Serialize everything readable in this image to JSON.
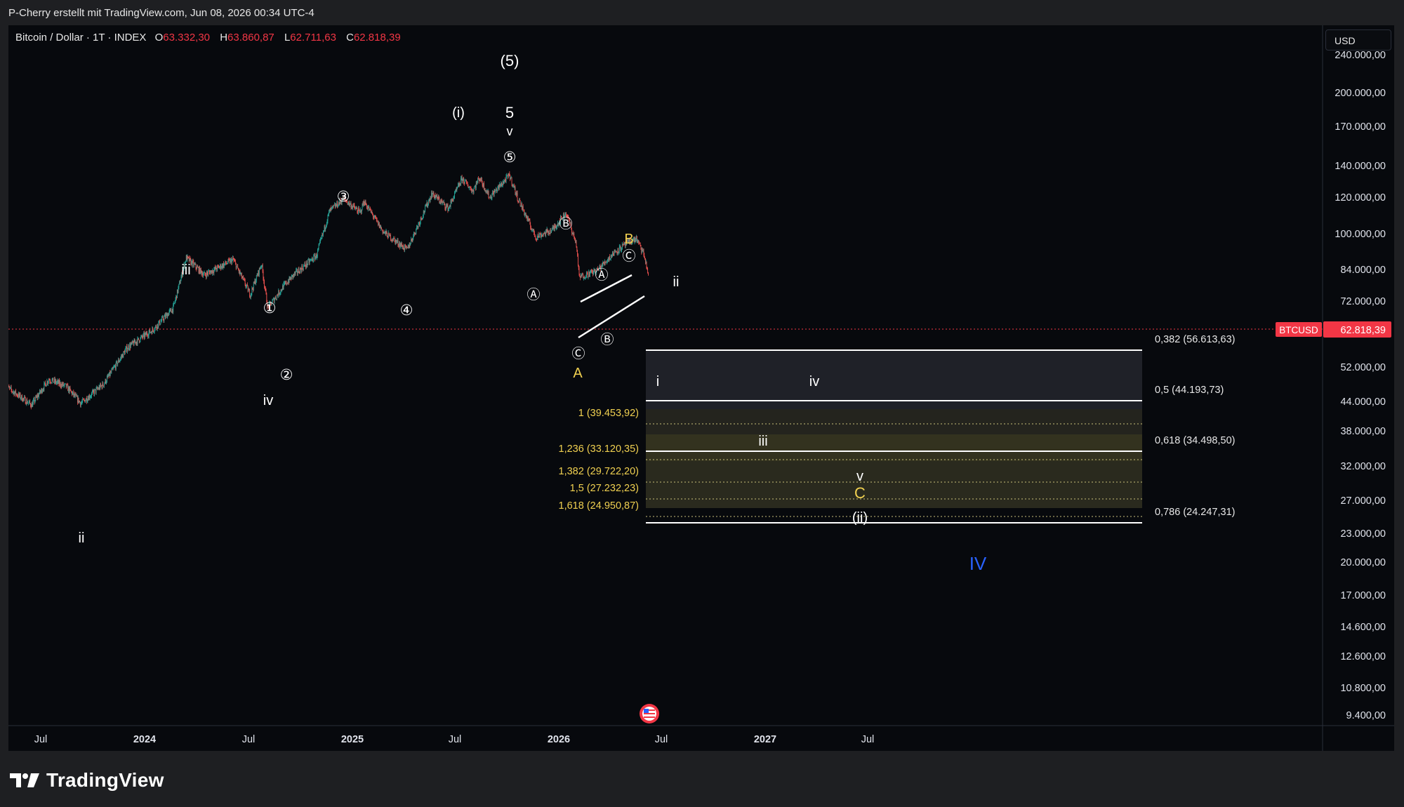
{
  "header": {
    "credit": "P-Cherry erstellt mit TradingView.com, Jun 08, 2026 00:34 UTC-4"
  },
  "legend": {
    "symbol": "Bitcoin / Dollar · 1T · INDEX",
    "open_label": "O",
    "open": "63.332,30",
    "high_label": "H",
    "high": "63.860,87",
    "low_label": "L",
    "low": "62.711,63",
    "close_label": "C",
    "close": "62.818,39"
  },
  "currency": "USD",
  "price_axis": {
    "ticks": [
      "240.000,00",
      "200.000,00",
      "170.000,00",
      "140.000,00",
      "120.000,00",
      "100.000,00",
      "84.000,00",
      "72.000,00",
      "52.000,00",
      "44.000,00",
      "38.000,00",
      "32.000,00",
      "27.000,00",
      "23.000,00",
      "20.000,00",
      "17.000,00",
      "14.600,00",
      "12.600,00",
      "10.800,00",
      "9.400,00"
    ]
  },
  "time_axis": {
    "ticks": [
      "Jul",
      "2024",
      "Jul",
      "2025",
      "Jul",
      "2026",
      "Jul",
      "2027",
      "Jul"
    ]
  },
  "price_tag": {
    "symbol": "BTCUSD",
    "value": "62.818,39"
  },
  "fib_right": [
    "0,382 (56.613,63)",
    "0,5 (44.193,73)",
    "0,618 (34.498,50)",
    "0,786 (24.247,31)"
  ],
  "fib_left": [
    "1 (39.453,92)",
    "1,236 (33.120,35)",
    "1,382 (29.722,20)",
    "1,5 (27.232,23)",
    "1,618 (24.950,87)"
  ],
  "wave_labels": {
    "w5_major": "(5)",
    "wi_paren": "(i)",
    "w5": "5",
    "wv_top": "v",
    "c5": "⑤",
    "c3": "③",
    "c1": "①",
    "c2": "②",
    "c4": "④",
    "iii_left": "iii",
    "iv_left": "iv",
    "ii_left": "ii",
    "cB_top": "Ⓑ",
    "cA_left": "Ⓐ",
    "cA_chan": "Ⓐ",
    "cC_chan": "Ⓒ",
    "cB_chan": "Ⓑ",
    "cC_bottom": "Ⓒ",
    "B": "B",
    "A": "A",
    "ii_right": "ii",
    "i_proj": "i",
    "iv_proj": "iv",
    "iii_proj": "iii",
    "v_proj": "v",
    "C": "C",
    "wii_paren": "(ii)",
    "IV": "IV"
  },
  "branding": {
    "name": "TradingView"
  },
  "colors": {
    "up": "#26a69a",
    "down": "#ef5350",
    "fib_gold": "#f0d050",
    "tag_red": "#f23645",
    "iv_blue": "#2962ff"
  },
  "chart_data": {
    "type": "candlestick",
    "y_scale": "log",
    "ylim": [
      9000,
      250000
    ],
    "x_range": [
      "2023-05-01",
      "2027-09-15"
    ],
    "last_close": 62818.39,
    "path": [
      [
        "2023-05-01",
        29000
      ],
      [
        "2023-06-15",
        25500
      ],
      [
        "2023-07-15",
        30500
      ],
      [
        "2023-08-15",
        29000
      ],
      [
        "2023-09-10",
        25800
      ],
      [
        "2023-10-20",
        29500
      ],
      [
        "2023-12-01",
        38000
      ],
      [
        "2024-01-15",
        43000
      ],
      [
        "2024-02-20",
        50000
      ],
      [
        "2024-03-14",
        71000
      ],
      [
        "2024-04-15",
        63000
      ],
      [
        "2024-06-05",
        70000
      ],
      [
        "2024-07-05",
        55000
      ],
      [
        "2024-07-25",
        68000
      ],
      [
        "2024-08-05",
        50000
      ],
      [
        "2024-09-01",
        58000
      ],
      [
        "2024-09-20",
        63000
      ],
      [
        "2024-10-30",
        72000
      ],
      [
        "2024-11-22",
        98000
      ],
      [
        "2024-12-17",
        107000
      ],
      [
        "2025-01-15",
        97000
      ],
      [
        "2025-01-22",
        105000
      ],
      [
        "2025-02-25",
        85000
      ],
      [
        "2025-04-08",
        75000
      ],
      [
        "2025-05-22",
        111000
      ],
      [
        "2025-06-20",
        100000
      ],
      [
        "2025-07-14",
        123000
      ],
      [
        "2025-08-02",
        113000
      ],
      [
        "2025-08-14",
        124000
      ],
      [
        "2025-09-01",
        108000
      ],
      [
        "2025-10-06",
        126000
      ],
      [
        "2025-10-20",
        108000
      ],
      [
        "2025-11-21",
        82000
      ],
      [
        "2025-12-20",
        86000
      ],
      [
        "2026-01-14",
        97000
      ],
      [
        "2026-02-01",
        78000
      ],
      [
        "2026-02-06",
        62000
      ],
      [
        "2026-03-10",
        65000
      ],
      [
        "2026-04-10",
        74000
      ],
      [
        "2026-05-05",
        79000
      ],
      [
        "2026-05-18",
        81000
      ],
      [
        "2026-06-01",
        72000
      ],
      [
        "2026-06-08",
        62800
      ]
    ],
    "fib_levels": [
      {
        "ratio": 0.382,
        "price": 56613.63
      },
      {
        "ratio": 0.5,
        "price": 44193.73
      },
      {
        "ratio": 0.618,
        "price": 34498.5
      },
      {
        "ratio": 0.786,
        "price": 24247.31
      },
      {
        "ratio": 1,
        "price": 39453.92
      },
      {
        "ratio": 1.236,
        "price": 33120.35
      },
      {
        "ratio": 1.382,
        "price": 29722.2
      },
      {
        "ratio": 1.5,
        "price": 27232.23
      },
      {
        "ratio": 1.618,
        "price": 24950.87
      }
    ]
  }
}
